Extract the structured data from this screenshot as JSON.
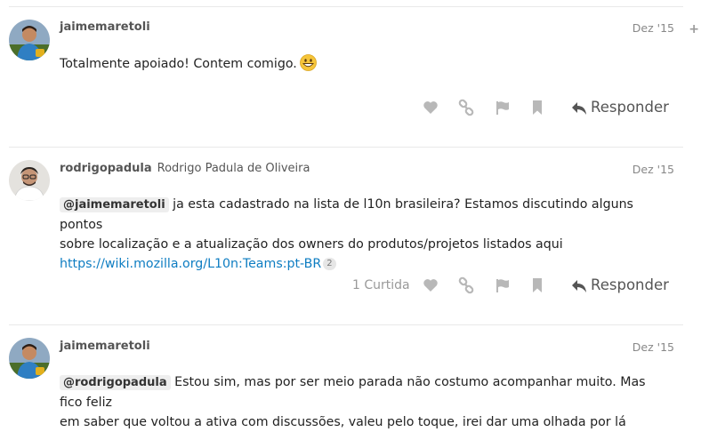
{
  "posts": [
    {
      "username": "jaimemaretoli",
      "fullname": "",
      "date": "Dez '15",
      "text": "Totalmente apoiado! Contem comigo.",
      "emoji": "grinning-face",
      "like_count_label": "",
      "reply_label": "Responder"
    },
    {
      "username": "rodrigopadula",
      "fullname": "Rodrigo Padula de Oliveira",
      "date": "Dez '15",
      "mention": "@jaimemaretoli",
      "text_line1": " ja esta cadastrado na lista de l10n brasileira? Estamos discutindo alguns pontos",
      "text_line2": "sobre localização e a atualização dos owners do produtos/projetos listados aqui",
      "link": "https://wiki.mozilla.org/L10n:Teams:pt-BR",
      "link_clicks": "2",
      "like_count_label": "1 Curtida",
      "reply_label": "Responder"
    },
    {
      "username": "jaimemaretoli",
      "fullname": "",
      "date": "Dez '15",
      "mention": "@rodrigopadula",
      "text_line1": " Estou sim, mas por ser meio parada não costumo acompanhar muito. Mas fico feliz",
      "text_line2": "em saber que voltou a ativa com discussões, valeu pelo toque, irei dar uma olhada por lá"
    }
  ],
  "ui": {
    "expand_symbol": "+",
    "icons": [
      "heart-icon",
      "link-icon",
      "flag-icon",
      "bookmark-icon",
      "reply-icon"
    ],
    "colors": {
      "link": "#0e7dc2",
      "muted": "#888888",
      "action": "#b0b0b0"
    }
  }
}
